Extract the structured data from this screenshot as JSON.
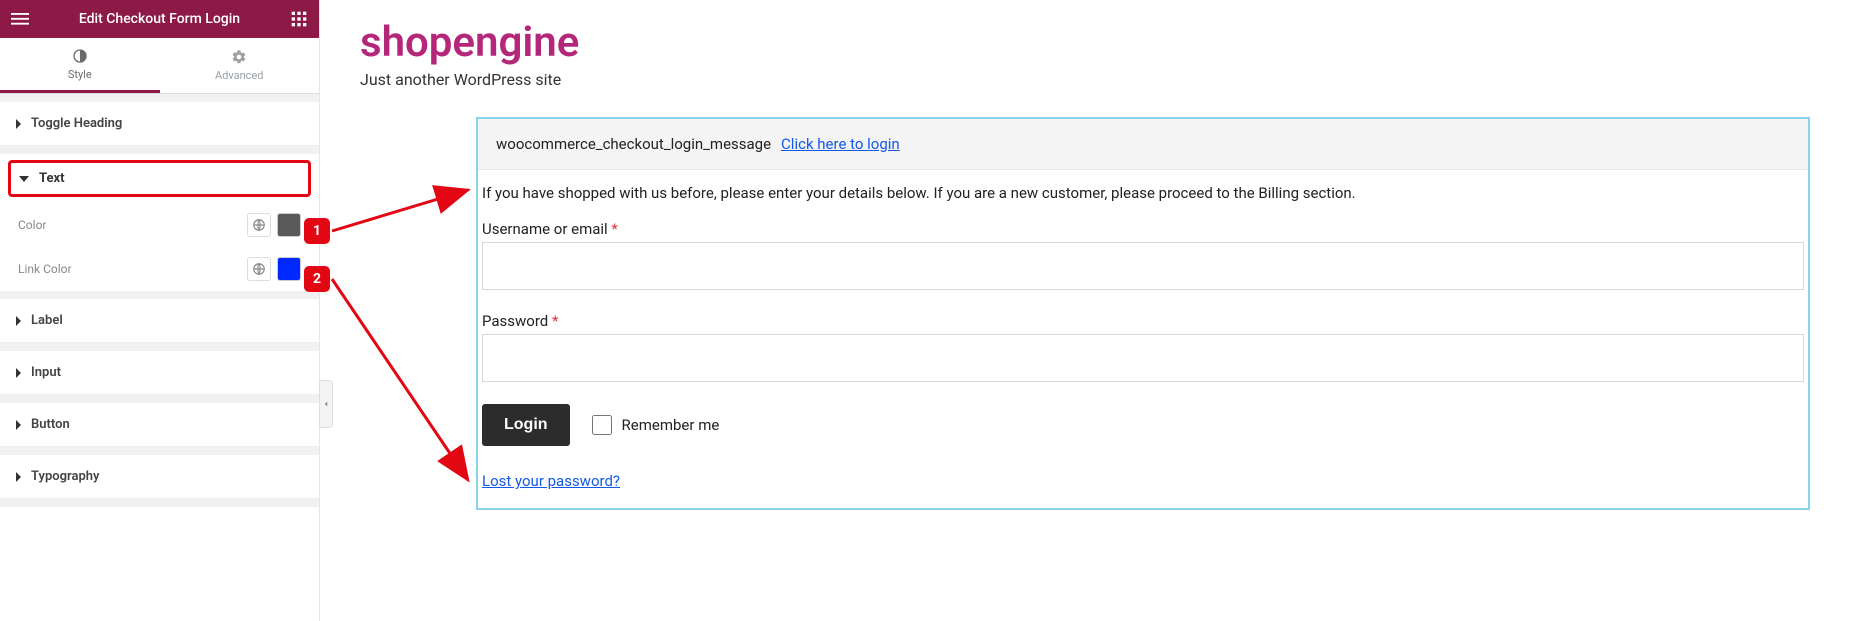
{
  "sidebar": {
    "title": "Edit Checkout Form Login",
    "tabs": {
      "style": "Style",
      "advanced": "Advanced"
    },
    "sections": {
      "toggle_heading": "Toggle Heading",
      "text": "Text",
      "label": "Label",
      "input": "Input",
      "button": "Button",
      "typography": "Typography"
    },
    "controls": {
      "color_label": "Color",
      "link_color_label": "Link Color",
      "color_value": "#595959",
      "link_color_value": "#0029ff"
    }
  },
  "preview": {
    "site_title": "shopengine",
    "site_tagline": "Just another WordPress site",
    "notice_hook": "woocommerce_checkout_login_message",
    "notice_link": "Click here to login",
    "intro_text": "If you have shopped with us before, please enter your details below. If you are a new customer, please proceed to the Billing section.",
    "username_label": "Username or email ",
    "password_label": "Password ",
    "required": "*",
    "login_button": "Login",
    "remember_label": "Remember me",
    "lost_password": "Lost your password?"
  },
  "annotations": {
    "badge1": "1",
    "badge2": "2"
  }
}
